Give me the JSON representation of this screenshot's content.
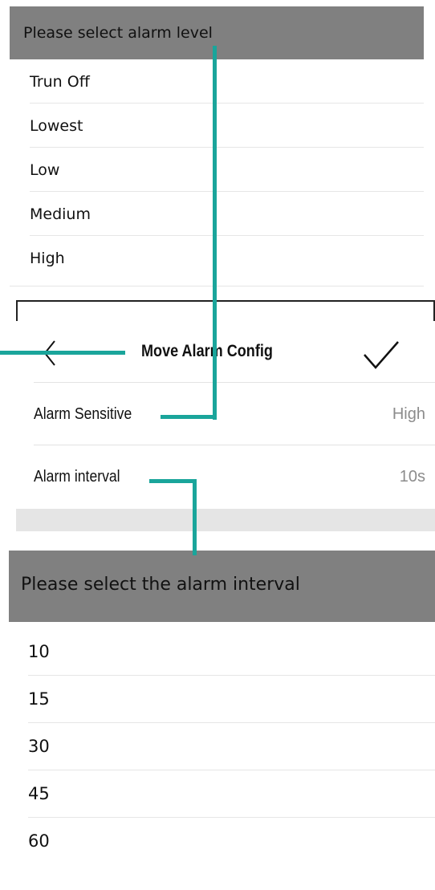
{
  "level_picker": {
    "title": "Please select alarm level",
    "options": [
      "Trun Off",
      "Lowest",
      "Low",
      "Medium",
      "High"
    ]
  },
  "config": {
    "title": "Move Alarm Config",
    "back_icon": "chevron-left-icon",
    "confirm_icon": "checkmark-icon",
    "rows": [
      {
        "label": "Alarm Sensitive",
        "value": "High"
      },
      {
        "label": "Alarm interval",
        "value": "10s"
      }
    ]
  },
  "interval_picker": {
    "title": "Please select the alarm interval",
    "options": [
      "10",
      "15",
      "30",
      "45",
      "60"
    ]
  },
  "colors": {
    "header_gray": "#808080",
    "callout_teal": "#1aa59b",
    "value_gray": "#8c8c8c"
  }
}
